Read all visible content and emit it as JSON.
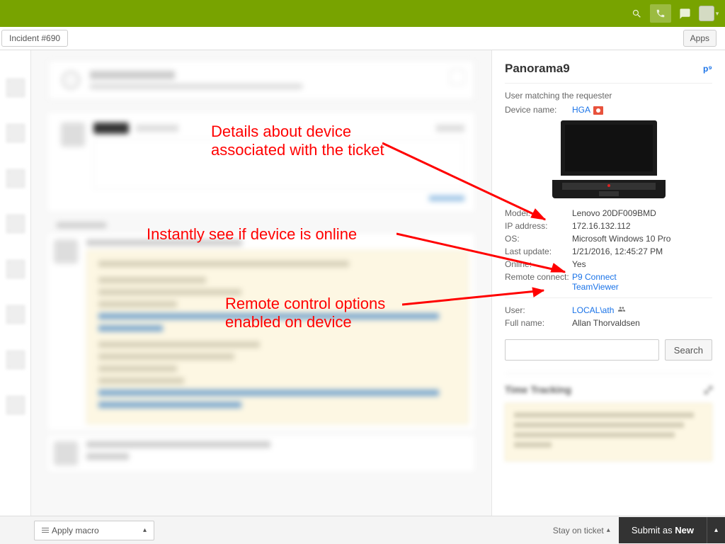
{
  "tab": {
    "label": "Incident #690"
  },
  "topbar": {
    "apps_button": "Apps"
  },
  "panel": {
    "title": "Panorama9",
    "logo_text": "p⁹",
    "matching_label": "User matching the requester",
    "device_name_label": "Device name:",
    "device_name": "HGA",
    "fields": {
      "model_label": "Model:",
      "model": "Lenovo 20DF009BMD",
      "ip_label": "IP address:",
      "ip": "172.16.132.112",
      "os_label": "OS:",
      "os": "Microsoft Windows 10 Pro",
      "last_update_label": "Last update:",
      "last_update": "1/21/2016, 12:45:27 PM",
      "online_label": "Online:",
      "online": "Yes",
      "remote_label": "Remote connect:",
      "remote_p9": "P9 Connect",
      "remote_tv": "TeamViewer",
      "user_label": "User:",
      "user": "LOCAL\\ath",
      "fullname_label": "Full name:",
      "fullname": "Allan Thorvaldsen"
    },
    "search_button": "Search",
    "time_tracking_title": "Time Tracking"
  },
  "footer": {
    "macro": "Apply macro",
    "stay": "Stay on ticket",
    "submit_prefix": "Submit as ",
    "submit_status": "New"
  },
  "annotations": {
    "a1_line1": "Details about device",
    "a1_line2": "associated with the ticket",
    "a2": "Instantly see if device is online",
    "a3_line1": "Remote control options",
    "a3_line2": "enabled on device"
  }
}
